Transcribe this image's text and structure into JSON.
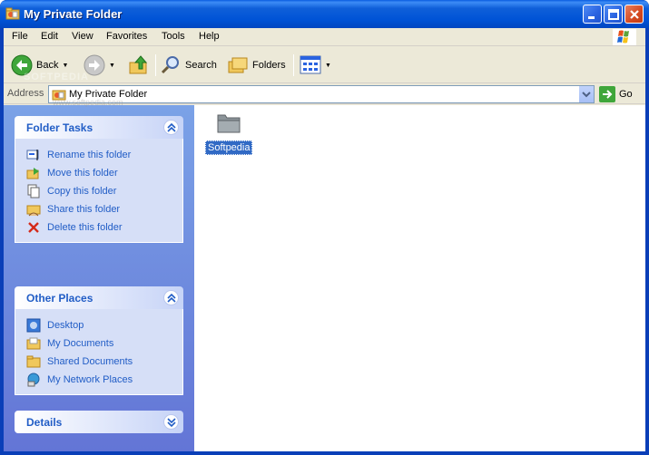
{
  "window": {
    "title": "My Private Folder"
  },
  "menu": [
    "File",
    "Edit",
    "View",
    "Favorites",
    "Tools",
    "Help"
  ],
  "toolbar": {
    "back_label": "Back",
    "search_label": "Search",
    "folders_label": "Folders"
  },
  "address": {
    "label": "Address",
    "value": "My Private Folder",
    "go_label": "Go"
  },
  "watermark": {
    "main": "SOFTPEDIA",
    "url": "www.softpedia.com"
  },
  "folder_tasks": {
    "title": "Folder Tasks",
    "items": [
      "Rename this folder",
      "Move this folder",
      "Copy this folder",
      "Share this folder",
      "Delete this folder"
    ]
  },
  "other_places": {
    "title": "Other Places",
    "items": [
      "Desktop",
      "My Documents",
      "Shared Documents",
      "My Network Places"
    ]
  },
  "details": {
    "title": "Details"
  },
  "files": [
    {
      "name": "Softpedia",
      "type": "folder",
      "selected": true
    }
  ],
  "colors": {
    "title_bar": "#0054e3",
    "task_link": "#215dc6",
    "selection": "#316ac5"
  }
}
